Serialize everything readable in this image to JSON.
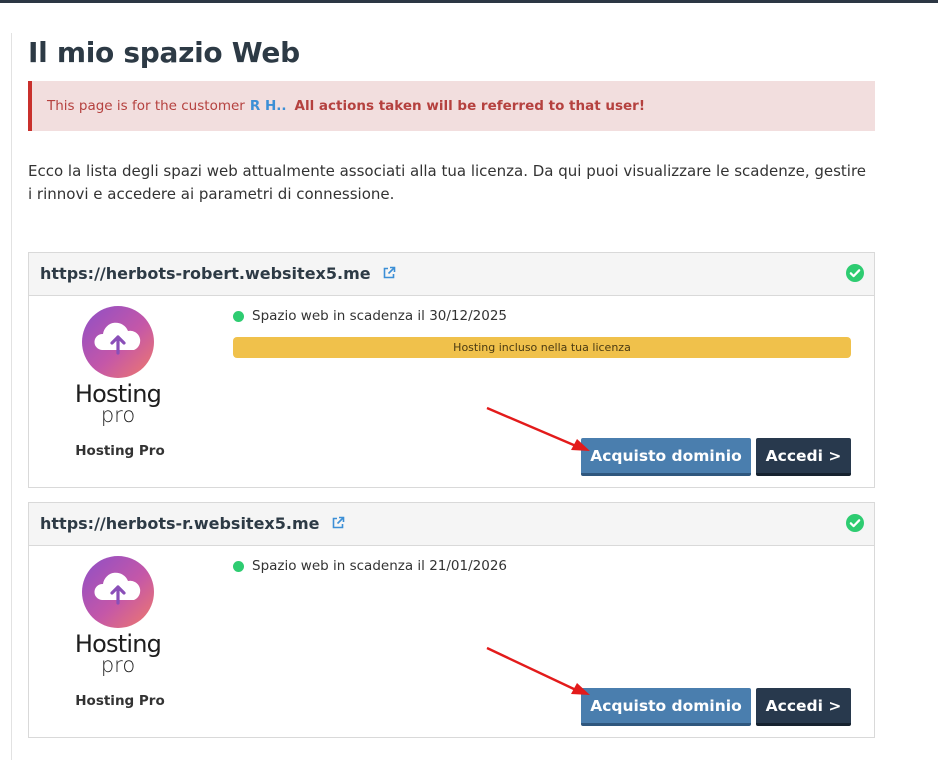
{
  "page": {
    "title": "Il mio spazio Web"
  },
  "alert": {
    "prefix": "This page is for the customer",
    "customer": "R H..",
    "warning": "All actions taken will be referred to that user!"
  },
  "intro": {
    "text": "Ecco la lista degli spazi web attualmente associati alla tua licenza. Da qui puoi visualizzare le scadenze, gestire i rinnovi e accedere ai parametri di connessione."
  },
  "colors": {
    "primary_button": "#4a7eae",
    "dark_button": "#28394d",
    "status_green": "#2ecc71",
    "alert_bg": "#f2dede",
    "hosting_bar": "#f0c14b",
    "annotation_arrow": "#e31b1b"
  },
  "icons": {
    "external_link": "external-link-icon",
    "status_ok": "check-circle-icon",
    "logo": "cloud-upload-icon"
  },
  "spaces": [
    {
      "url": "https://herbots-robert.websitex5.me",
      "logo_word": "Hosting",
      "logo_sub": "pro",
      "product_name": "Hosting Pro",
      "status": "Spazio web in scadenza il 30/12/2025",
      "bar_label": "Hosting incluso nella tua licenza",
      "buy_label": "Acquisto dominio",
      "login_label": "Accedi >"
    },
    {
      "url": "https://herbots-r.websitex5.me",
      "logo_word": "Hosting",
      "logo_sub": "pro",
      "product_name": "Hosting Pro",
      "status": "Spazio web in scadenza il 21/01/2026",
      "buy_label": "Acquisto dominio",
      "login_label": "Accedi >"
    }
  ]
}
